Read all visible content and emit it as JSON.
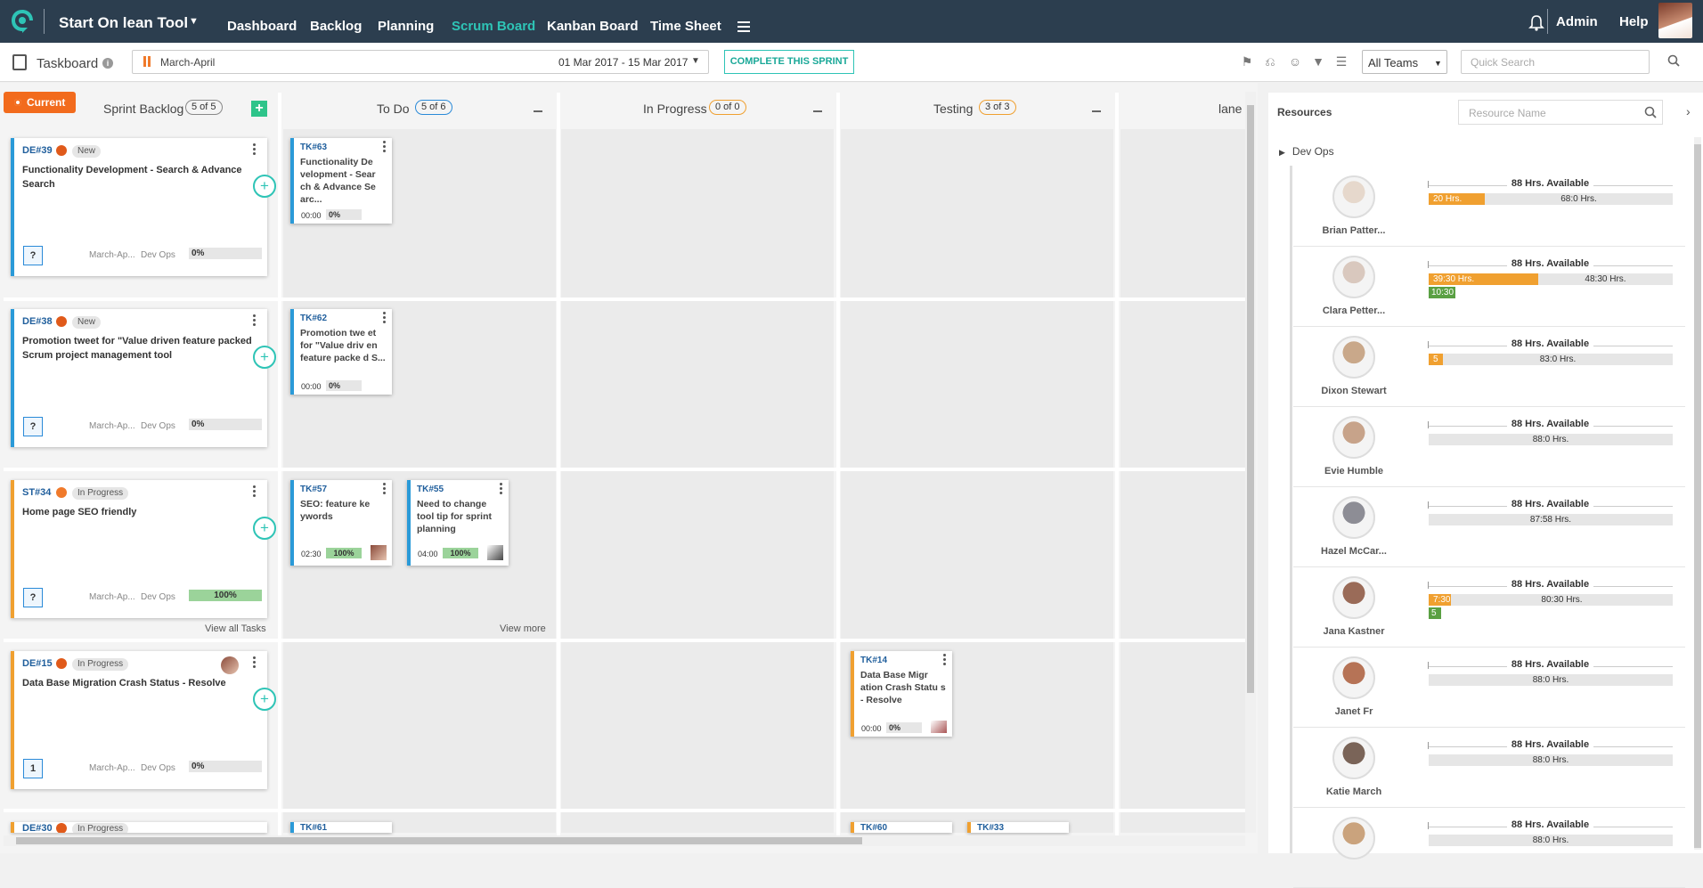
{
  "app": {
    "name": "Start On lean Tool",
    "nav": [
      "Dashboard",
      "Backlog",
      "Planning",
      "Scrum Board",
      "Kanban Board",
      "Time Sheet"
    ],
    "active_nav": "Scrum Board",
    "admin": "Admin",
    "help": "Help"
  },
  "toolbar": {
    "title": "Taskboard",
    "sprint_name": "March-April",
    "sprint_dates": "01 Mar 2017 - 15 Mar 2017",
    "complete_label": "COMPLETE THIS SPRINT",
    "team": "All Teams",
    "search_placeholder": "Quick Search"
  },
  "board": {
    "current_label": "Current",
    "columns": [
      {
        "name": "Sprint Backlog",
        "count": "5 of 5"
      },
      {
        "name": "To Do",
        "count": "5 of 6"
      },
      {
        "name": "In Progress",
        "count": "0 of 0"
      },
      {
        "name": "Testing",
        "count": "3 of 3"
      },
      {
        "name": "lane",
        "count": ""
      }
    ],
    "stories": [
      {
        "id": "DE#39",
        "status": "New",
        "title": "Functionality Development - Search & Advance Search",
        "q": "?",
        "sprint": "March-Ap...",
        "team": "Dev Ops",
        "progress": "0%"
      },
      {
        "id": "DE#38",
        "status": "New",
        "title": "Promotion tweet for \"Value driven feature packed Scrum project management tool",
        "q": "?",
        "sprint": "March-Ap...",
        "team": "Dev Ops",
        "progress": "0%"
      },
      {
        "id": "ST#34",
        "status": "In Progress",
        "title": "Home page SEO friendly",
        "q": "?",
        "sprint": "March-Ap...",
        "team": "Dev Ops",
        "progress": "100%"
      },
      {
        "id": "DE#15",
        "status": "In Progress",
        "title": "Data Base Migration Crash Status - Resolve",
        "q": "1",
        "sprint": "March-Ap...",
        "team": "Dev Ops",
        "progress": "0%"
      },
      {
        "id": "DE#30",
        "status": "In Progress",
        "title": "",
        "q": "",
        "sprint": "",
        "team": "",
        "progress": ""
      }
    ],
    "tasks": [
      {
        "id": "TK#63",
        "title": "Functionality De velopment - Sear ch & Advance Se arc...",
        "time": "00:00",
        "progress": "0%"
      },
      {
        "id": "TK#62",
        "title": "Promotion twe et for \"Value driv en feature packe d S...",
        "time": "00:00",
        "progress": "0%"
      },
      {
        "id": "TK#57",
        "title": "SEO: feature ke ywords",
        "time": "02:30",
        "progress": "100%"
      },
      {
        "id": "TK#55",
        "title": "Need to change tool tip for sprint planning",
        "time": "04:00",
        "progress": "100%"
      },
      {
        "id": "TK#14",
        "title": "Data Base Migr ation Crash Statu s - Resolve",
        "time": "00:00",
        "progress": "0%"
      },
      {
        "id": "TK#61",
        "title": "",
        "time": "",
        "progress": ""
      },
      {
        "id": "TK#60",
        "title": "",
        "time": "",
        "progress": ""
      },
      {
        "id": "TK#33",
        "title": "",
        "time": "",
        "progress": ""
      }
    ],
    "view_all": "View all Tasks",
    "view_more": "View more"
  },
  "resources": {
    "title": "Resources",
    "search_placeholder": "Resource Name",
    "group": "Dev Ops",
    "people": [
      {
        "name": "Brian Patter...",
        "available": "88 Hrs. Available",
        "used": "20 Hrs.",
        "remaining": "68:0 Hrs.",
        "extra": "",
        "used_frac": 0.23
      },
      {
        "name": "Clara Petter...",
        "available": "88 Hrs. Available",
        "used": "39:30 Hrs.",
        "remaining": "48:30 Hrs.",
        "extra": "10:30",
        "used_frac": 0.45
      },
      {
        "name": "Dixon Stewart",
        "available": "88 Hrs. Available",
        "used": "5",
        "remaining": "83:0 Hrs.",
        "extra": "",
        "used_frac": 0.06
      },
      {
        "name": "Evie Humble",
        "available": "88 Hrs. Available",
        "used": "",
        "remaining": "88:0 Hrs.",
        "extra": "",
        "used_frac": 0
      },
      {
        "name": "Hazel McCar...",
        "available": "88 Hrs. Available",
        "used": "",
        "remaining": "87:58 Hrs.",
        "extra": "",
        "used_frac": 0
      },
      {
        "name": "Jana Kastner",
        "available": "88 Hrs. Available",
        "used": "7:30",
        "remaining": "80:30 Hrs.",
        "extra": "5",
        "used_frac": 0.09
      },
      {
        "name": "Janet Fr",
        "available": "88 Hrs. Available",
        "used": "",
        "remaining": "88:0 Hrs.",
        "extra": "",
        "used_frac": 0
      },
      {
        "name": "Katie March",
        "available": "88 Hrs. Available",
        "used": "",
        "remaining": "88:0 Hrs.",
        "extra": "",
        "used_frac": 0
      },
      {
        "name": "",
        "available": "88 Hrs. Available",
        "used": "",
        "remaining": "88:0 Hrs.",
        "extra": "",
        "used_frac": 0
      }
    ]
  },
  "colors": {
    "nav_bg": "#2c3e4f",
    "accent": "#2ec4b6",
    "current": "#f26b1d",
    "story_blue": "#2a9ad8",
    "story_orange": "#f0a030",
    "progress_done": "#9bd39a",
    "resource_used": "#f0a030",
    "resource_over": "#5aa043"
  }
}
